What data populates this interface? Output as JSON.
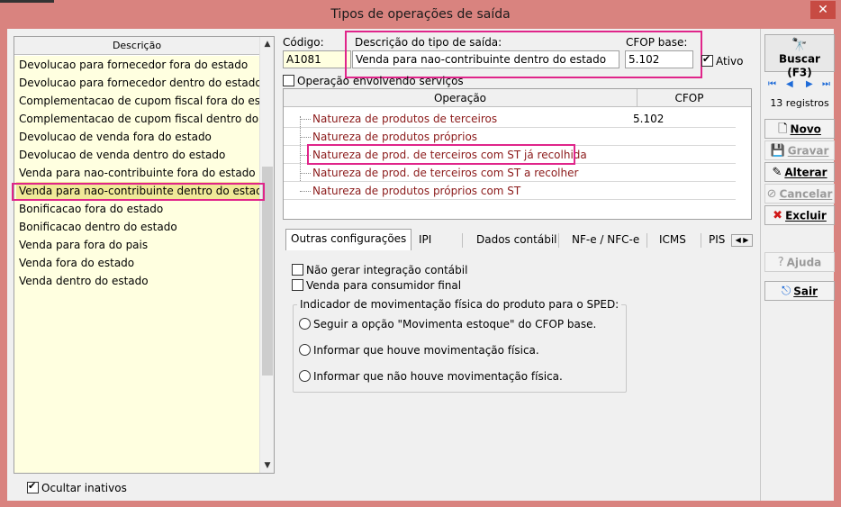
{
  "window": {
    "title": "Tipos de operações de saída",
    "close_glyph": "✕"
  },
  "list": {
    "header": "Descrição",
    "items": [
      "Devolucao para fornecedor fora do estado",
      "Devolucao para fornecedor dentro do estado",
      "Complementacao de cupom fiscal fora do estado",
      "Complementacao de cupom fiscal dentro do estado",
      "Devolucao de venda fora do estado",
      "Devolucao de venda dentro do estado",
      "Venda para nao-contribuinte fora do estado",
      "Venda para nao-contribuinte dentro do estado",
      "Bonificacao fora do estado",
      "Bonificacao dentro do estado",
      "Venda para fora do pais",
      "Venda fora do estado",
      "Venda dentro do estado"
    ],
    "selected_index": 7
  },
  "ocultar_inativos": {
    "label": "Ocultar inativos",
    "checked": true
  },
  "form": {
    "codigo_label": "Código:",
    "codigo_value": "A1081",
    "descricao_label": "Descrição do tipo de saída:",
    "descricao_value": "Venda para nao-contribuinte dentro do estado",
    "cfop_base_label": "CFOP base:",
    "cfop_base_value": "5.102",
    "ativo_label": "Ativo",
    "servicos_label": "Operação envolvendo serviços"
  },
  "grid": {
    "col_operacao": "Operação",
    "col_cfop": "CFOP",
    "rows": [
      {
        "op": "Natureza de produtos de terceiros",
        "cfop": "5.102"
      },
      {
        "op": "Natureza de produtos próprios",
        "cfop": ""
      },
      {
        "op": "Natureza de prod. de terceiros com ST já recolhida",
        "cfop": ""
      },
      {
        "op": "Natureza de prod. de terceiros com ST a recolher",
        "cfop": ""
      },
      {
        "op": "Natureza de produtos próprios com ST",
        "cfop": ""
      }
    ]
  },
  "tabs": [
    "Outras configurações",
    "IPI",
    "Dados contábil",
    "NF-e / NFC-e",
    "ICMS",
    "PIS"
  ],
  "options": {
    "nao_gerar": "Não gerar integração contábil",
    "venda_consumidor": "Venda para consumidor final",
    "group_title": "Indicador de movimentação física do produto para o SPED:",
    "radio1": "Seguir a opção \"Movimenta estoque\" do CFOP base.",
    "radio2": "Informar que houve movimentação física.",
    "radio3": "Informar que não houve movimentação física."
  },
  "sidebar": {
    "buscar": "Buscar (F3)",
    "registros": "13 registros",
    "novo": "Novo",
    "gravar": "Gravar",
    "alterar": "Alterar",
    "cancelar": "Cancelar",
    "excluir": "Excluir",
    "ajuda": "Ajuda",
    "sair": "Sair"
  },
  "colors": {
    "highlight": "#e0258a",
    "titlebar": "#d9837f",
    "list_bg": "#ffffe0"
  }
}
